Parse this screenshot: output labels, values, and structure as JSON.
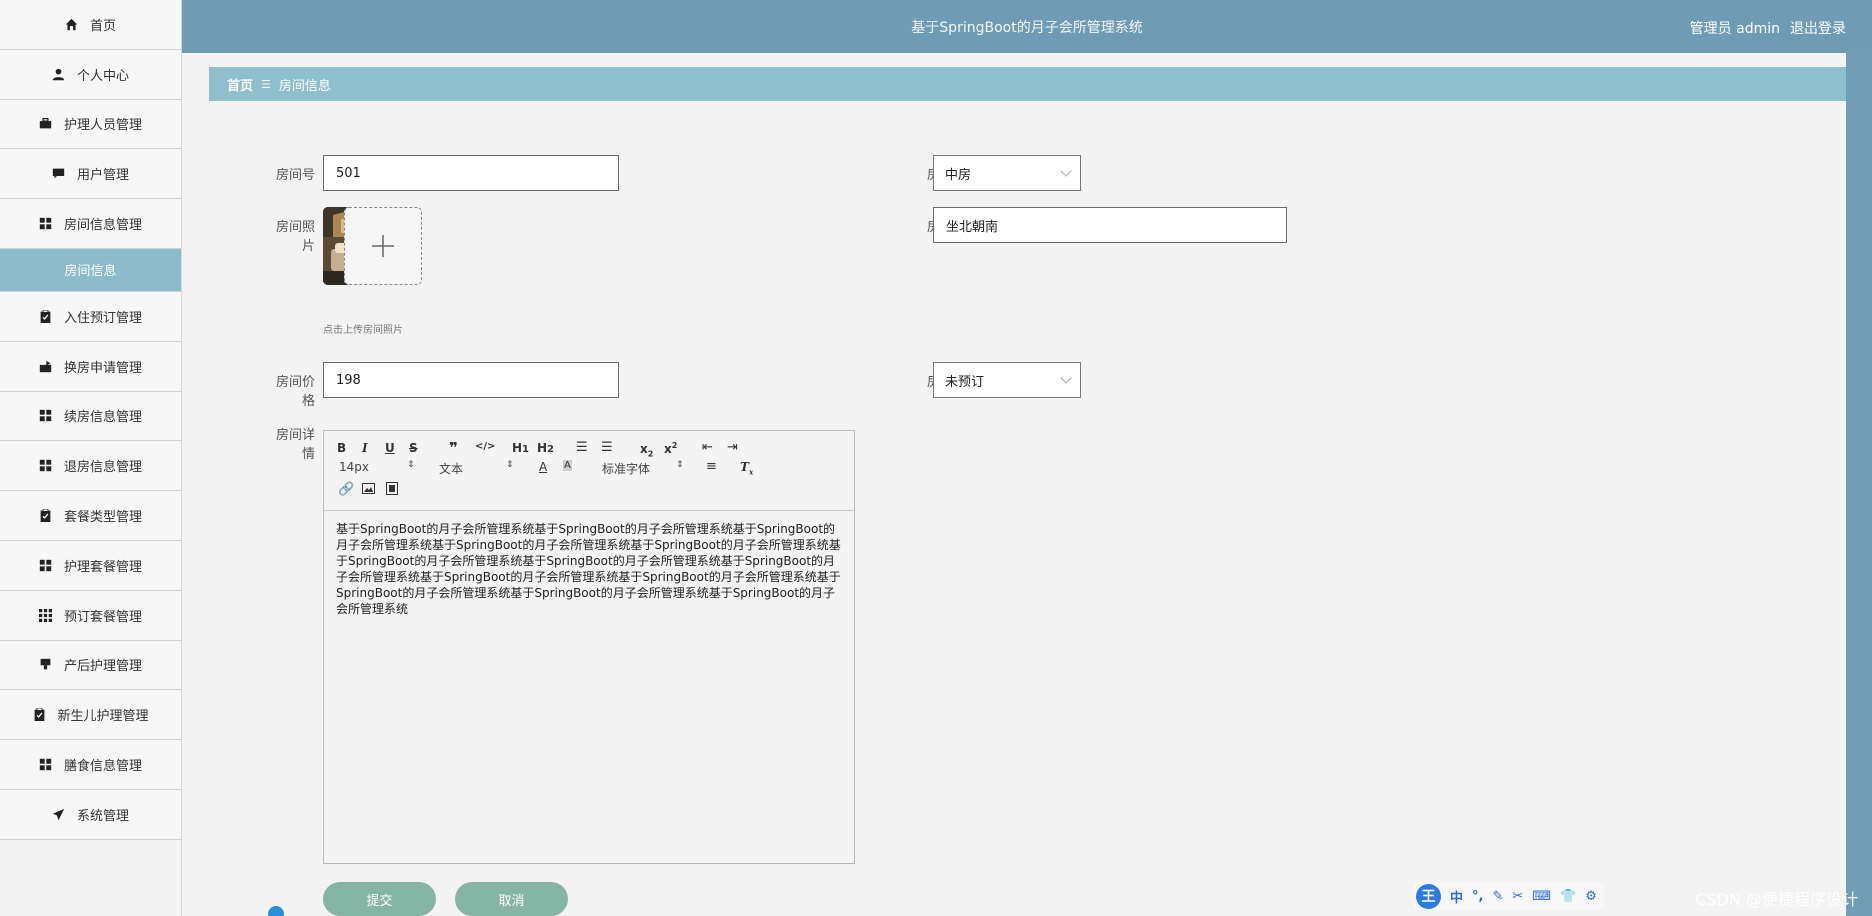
{
  "header": {
    "title": "基于SpringBoot的月子会所管理系统",
    "user": "管理员 admin",
    "logout": "退出登录"
  },
  "sidebar": {
    "items": [
      {
        "label": "首页",
        "icon": "home-icon"
      },
      {
        "label": "个人中心",
        "icon": "user-icon"
      },
      {
        "label": "护理人员管理",
        "icon": "briefcase-icon"
      },
      {
        "label": "用户管理",
        "icon": "comment-icon"
      },
      {
        "label": "房间信息管理",
        "icon": "grid-icon"
      },
      {
        "label": "房间信息",
        "icon": ""
      },
      {
        "label": "入住预订管理",
        "icon": "clipboard-icon"
      },
      {
        "label": "换房申请管理",
        "icon": "swap-icon"
      },
      {
        "label": "续房信息管理",
        "icon": "grid-icon"
      },
      {
        "label": "退房信息管理",
        "icon": "grid-icon"
      },
      {
        "label": "套餐类型管理",
        "icon": "clipboard-icon"
      },
      {
        "label": "护理套餐管理",
        "icon": "grid-icon"
      },
      {
        "label": "预订套餐管理",
        "icon": "grid9-icon"
      },
      {
        "label": "产后护理管理",
        "icon": "monitor-icon"
      },
      {
        "label": "新生儿护理管理",
        "icon": "clipboard-icon"
      },
      {
        "label": "膳食信息管理",
        "icon": "grid-icon"
      },
      {
        "label": "系统管理",
        "icon": "send-icon"
      }
    ]
  },
  "breadcrumb": {
    "home": "首页",
    "sep": "☰",
    "current": "房间信息"
  },
  "form": {
    "room_no_label": "房间号",
    "room_no": "501",
    "room_type_label": "房间类型",
    "room_type": "中房",
    "photo_label": "房间照片",
    "upload_hint": "点击上传房间照片",
    "orientation_label": "房间朝向",
    "orientation": "坐北朝南",
    "price_label": "房间价格",
    "price": "198",
    "status_label": "房间状态",
    "status": "未预订",
    "detail_label": "房间详情",
    "detail_text": "基于SpringBoot的月子会所管理系统基于SpringBoot的月子会所管理系统基于SpringBoot的月子会所管理系统基于SpringBoot的月子会所管理系统基于SpringBoot的月子会所管理系统基于SpringBoot的月子会所管理系统基于SpringBoot的月子会所管理系统基于SpringBoot的月子会所管理系统基于SpringBoot的月子会所管理系统基于SpringBoot的月子会所管理系统基于SpringBoot的月子会所管理系统基于SpringBoot的月子会所管理系统基于SpringBoot的月子会所管理系统",
    "submit": "提交",
    "cancel": "取消"
  },
  "editor": {
    "font_size": "14px",
    "block_type": "文本",
    "font_family": "标准字体"
  },
  "ime": {
    "logo": "王",
    "lang": "中"
  },
  "watermark": "CSDN @便捷程序设计"
}
